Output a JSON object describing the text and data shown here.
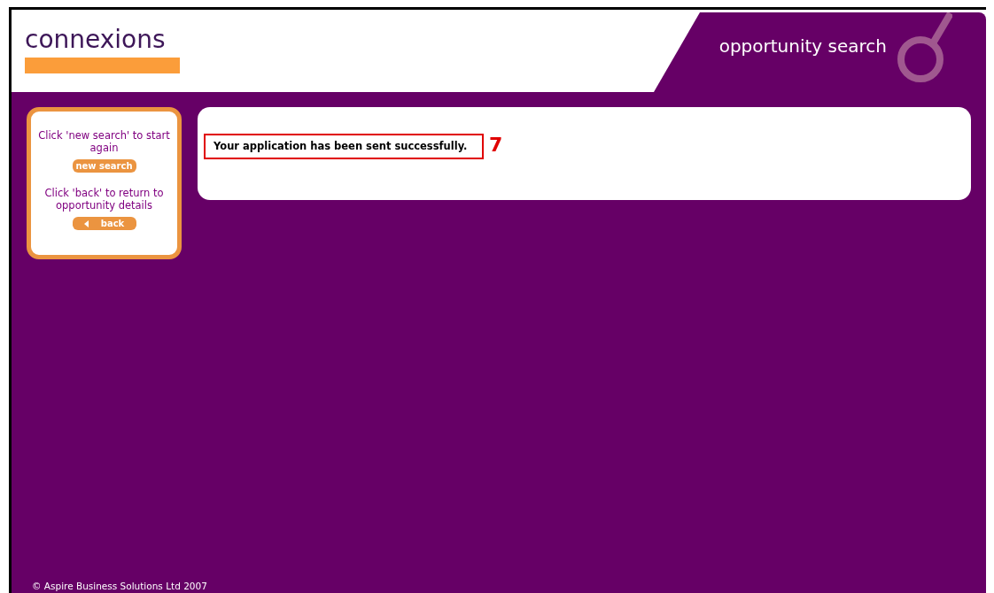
{
  "header": {
    "logo": "connexions",
    "title": "opportunity search"
  },
  "sidebar": {
    "items": [
      {
        "text": "Click 'new search' to start again",
        "button": "new search",
        "kind": "plain"
      },
      {
        "text": "Click 'back' to return to opportunity details",
        "button": "back",
        "kind": "back"
      }
    ]
  },
  "message": {
    "text": "Your application has been sent successfully.",
    "annotation": "7"
  },
  "footer": {
    "copyright": "© Aspire Business Solutions Ltd 2007"
  }
}
